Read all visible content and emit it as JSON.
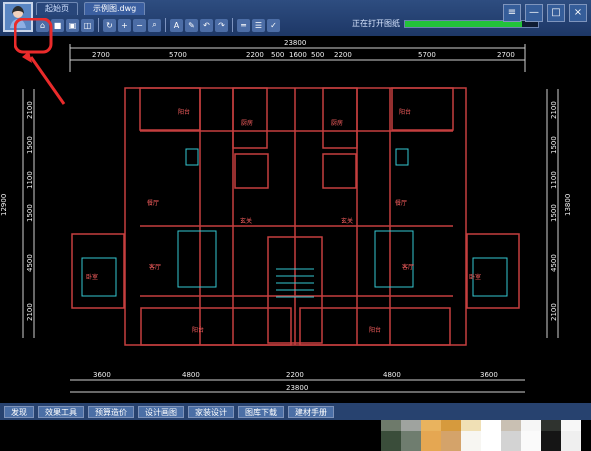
{
  "app": {
    "tabs": [
      "起始页",
      "示例图.dwg"
    ],
    "active_tab_index": 1,
    "progress_label": "正在打开图纸",
    "progress_value": 0.88
  },
  "toolbar_icons": [
    "open-icon",
    "save-icon",
    "lock-icon",
    "unlock-icon",
    "refresh-icon",
    "zoom-in-icon",
    "zoom-out-icon",
    "text-icon",
    "brush-icon",
    "undo-icon",
    "redo-icon",
    "ruler-icon",
    "layers-icon",
    "check-icon"
  ],
  "window": {
    "minimize_symbol": "—",
    "maximize_symbol": "□",
    "close_symbol": "×",
    "settings_symbol": "≡"
  },
  "plan": {
    "top_total": "23800",
    "top_dims": [
      "2700",
      "5700",
      "2200",
      "500",
      "1600",
      "500",
      "2200",
      "5700",
      "2700"
    ],
    "bottom_dims": [
      "3600",
      "4800",
      "2200",
      "4800",
      "3600"
    ],
    "bottom_total": "23800",
    "left_dims": [
      "2100",
      "1500",
      "1100",
      "1500",
      "4500",
      "2100"
    ],
    "left_total": "12900",
    "right_dims": [
      "2100",
      "1500",
      "1100",
      "1500",
      "4500",
      "2100"
    ],
    "right_total": "13800",
    "rooms": {
      "top_left_balcony": "阳台",
      "top_left_kitchen": "厨房",
      "top_right_kitchen": "厨房",
      "top_right_balcony": "阳台",
      "left_dining": "餐厅",
      "right_dining": "餐厅",
      "left_entry": "玄关",
      "right_entry": "玄关",
      "left_bedroom": "卧室",
      "left_living": "客厅",
      "right_living": "客厅",
      "right_bedroom": "卧室",
      "bottom_left_balcony": "阳台",
      "bottom_right_balcony": "阳台"
    }
  },
  "bottom_buttons": [
    "发现",
    "效果工具",
    "预算造价",
    "设计画图",
    "家装设计",
    "图库下载",
    "建材手册"
  ],
  "mosaic_colors": [
    "#6e7a6b",
    "#9fa39f",
    "#e9b35e",
    "#d69a3d",
    "#f0e0b5",
    "#ffffff",
    "#c9c0b3",
    "#f6f6f6",
    "#2f332f",
    "#f7f7f7",
    "#3a4d3a",
    "#6f7d6f",
    "#e5a752",
    "#d4a36a",
    "#f7f6f2",
    "#ffffff",
    "#d3d3d3",
    "#fafafa",
    "#151515",
    "#efefef"
  ]
}
